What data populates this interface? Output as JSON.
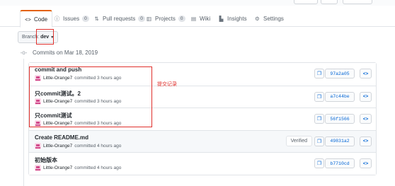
{
  "tabs": [
    {
      "label": "Code",
      "icon": "code-icon",
      "selected": true
    },
    {
      "label": "Issues",
      "icon": "issue-icon",
      "count": "0"
    },
    {
      "label": "Pull requests",
      "icon": "pull-request-icon",
      "count": "0"
    },
    {
      "label": "Projects",
      "icon": "project-icon",
      "count": "0"
    },
    {
      "label": "Wiki",
      "icon": "book-icon"
    },
    {
      "label": "Insights",
      "icon": "graph-icon"
    },
    {
      "label": "Settings",
      "icon": "gear-icon"
    }
  ],
  "branch": {
    "label": "Branch:",
    "value": "dev"
  },
  "date_group": {
    "label": "Commits on Mar 18, 2019"
  },
  "commits": [
    {
      "message": "commit and push",
      "author": "Little-Orange7",
      "time": "committed 3 hours ago",
      "sha": "97a2a05"
    },
    {
      "message": "只commit测试。2",
      "author": "Little-Orange7",
      "time": "committed 3 hours ago",
      "sha": "a7c44be"
    },
    {
      "message": "只commit测试",
      "author": "Little-Orange7",
      "time": "committed 3 hours ago",
      "sha": "56f1566"
    },
    {
      "message": "Create README.md",
      "author": "Little-Orange7",
      "time": "committed 4 hours ago",
      "sha": "49831a2",
      "verified": "Verified"
    },
    {
      "message": "初始版本",
      "author": "Little-Orange7",
      "time": "committed 4 hours ago",
      "sha": "b7710cd"
    }
  ],
  "annotation": {
    "text": "提交记录",
    "color": "#e0302c"
  },
  "colors": {
    "accent": "#e36209",
    "link": "#0366d6",
    "annotation": "#e0302c"
  }
}
